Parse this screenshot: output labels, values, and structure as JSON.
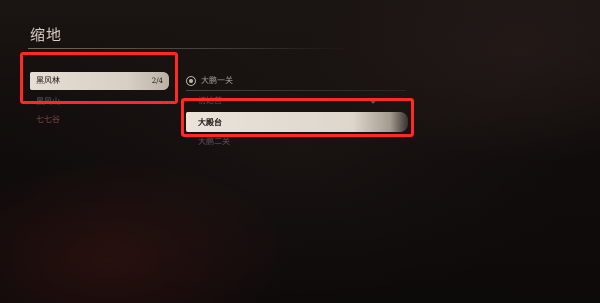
{
  "page": {
    "title": "缩地"
  },
  "regions": [
    {
      "label": "黑风林",
      "count": "2/4",
      "selected": true
    },
    {
      "label": "黑风山",
      "selected": false
    },
    {
      "label": "七七谷",
      "selected": false
    }
  ],
  "locations": {
    "header": "大鹏一关",
    "items": [
      {
        "label": "初始营",
        "mark": "◆",
        "selected": false
      },
      {
        "label": "大殿台",
        "selected": true
      },
      {
        "label": "大鹏二关",
        "selected": false
      }
    ]
  },
  "colors": {
    "highlight": "#ff2a26",
    "selected_bar": "#ece5d8",
    "background": "#120e0d"
  }
}
